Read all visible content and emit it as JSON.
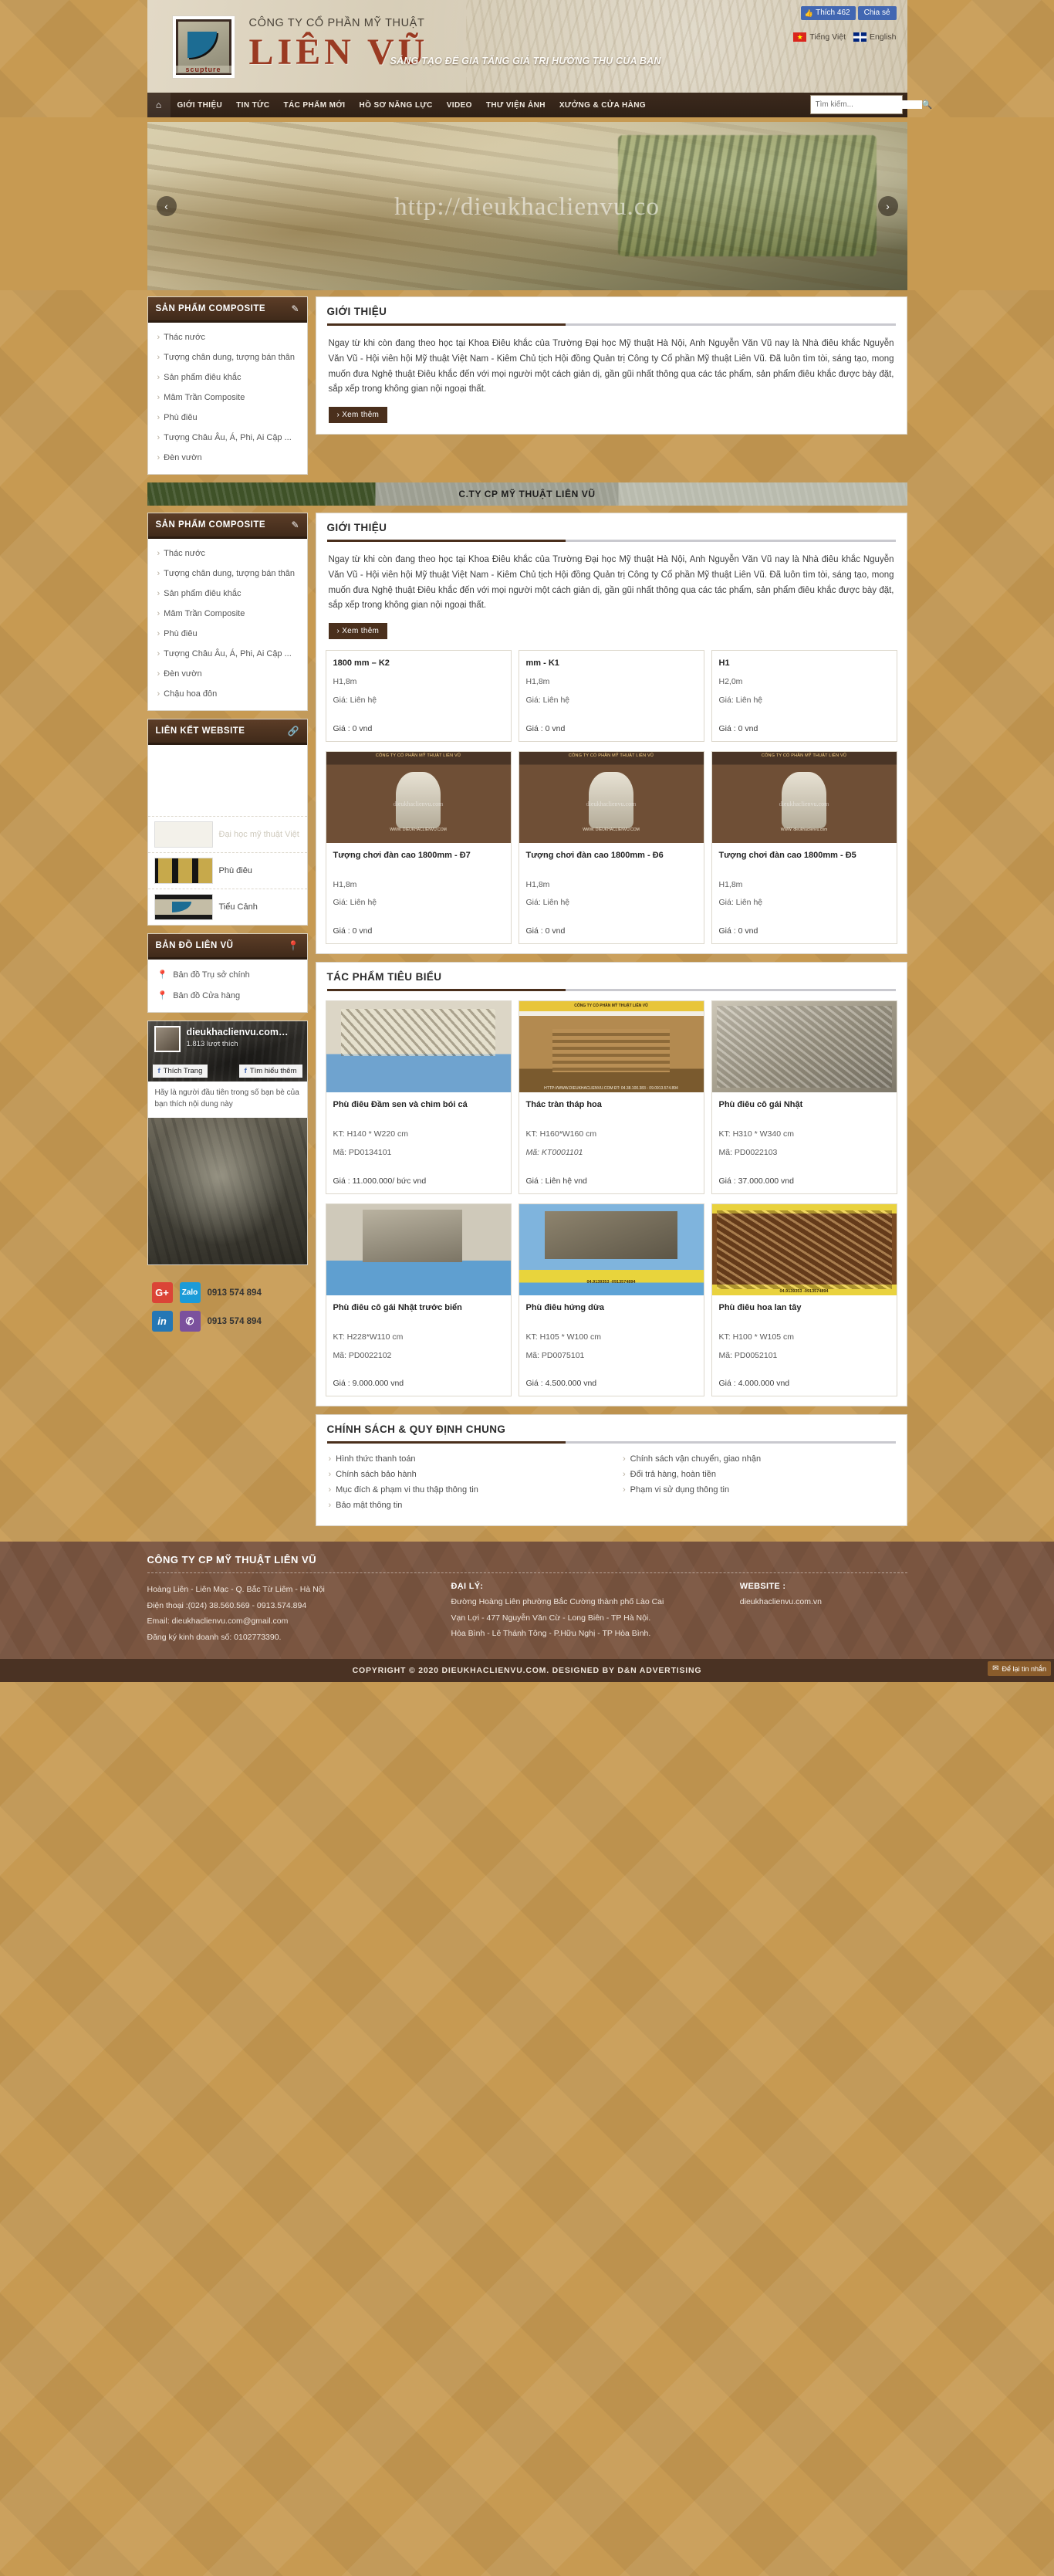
{
  "header": {
    "company_sub": "CÔNG TY CỔ PHẦN MỸ THUẬT",
    "company_main": "LIÊN VŨ",
    "tagline": "SÁNG TẠO ĐỂ GIA TĂNG GIÁ TRỊ HƯỞNG THỤ CỦA BẠN",
    "logo_word": "scupture",
    "fb_like": "Thích 462",
    "fb_share": "Chia sẻ",
    "lang_vi": "Tiếng Việt",
    "lang_en": "English"
  },
  "nav": {
    "home_icon": "home-icon",
    "items": [
      "GIỚI THIỆU",
      "TIN TỨC",
      "TÁC PHẨM MỚI",
      "HỒ SƠ NĂNG LỰC",
      "VIDEO",
      "THƯ VIỆN ẢNH",
      "XƯỞNG & CỬA HÀNG"
    ],
    "search_placeholder": "Tìm kiếm...",
    "search_value": ""
  },
  "slider": {
    "watermark": "http://dieukhaclienvu.co",
    "prev": "‹",
    "next": "›"
  },
  "sidebar": {
    "composite_panel": {
      "title": "SẢN PHẨM COMPOSITE",
      "icon": "edit-icon",
      "items": [
        "Thác nước",
        "Tượng chân dung, tượng bán thân",
        "Sản phẩm điêu khắc",
        "Mâm Trần Composite",
        "Phù điêu",
        "Tượng Châu Âu, Á, Phi, Ai Cập ...",
        "Đèn vườn",
        "Chậu hoa đôn"
      ]
    },
    "links_panel": {
      "title": "LIÊN KẾT WEBSITE",
      "icon": "link-icon",
      "items": [
        {
          "label": "Đại học mỹ thuật Việt"
        },
        {
          "label": "Phù điêu"
        },
        {
          "label": "Tiểu Cảnh"
        }
      ]
    },
    "map_panel": {
      "title": "BẢN ĐỒ LIÊN VŨ",
      "icon": "map-pin-icon",
      "items": [
        "Bản đồ Trụ sở chính",
        "Bản đồ Cửa hàng"
      ]
    },
    "facebook": {
      "page_name": "dieukhaclienvu.com…",
      "likes": "1.813 lượt thích",
      "like_btn": "Thích Trang",
      "learn_btn": "Tìm hiểu thêm",
      "note": "Hãy là người đầu tiên trong số bạn bè của bạn thích nội dung này"
    },
    "social": [
      {
        "icon": "google-plus-icon",
        "icon2": "zalo-icon",
        "phone": "0913 574 894"
      },
      {
        "icon": "linkedin-icon",
        "icon2": "viber-icon",
        "phone": "0913 574 894"
      }
    ]
  },
  "intro_block": {
    "title": "GIỚI THIỆU",
    "text": "Ngay từ khi còn đang theo học tại Khoa Điêu khắc của Trường Đại học Mỹ thuật Hà Nội, Anh Nguyễn Văn Vũ nay là Nhà điêu khắc Nguyễn Văn Vũ - Hội viên hội Mỹ thuật Việt Nam - Kiêm Chủ tịch Hội đồng Quản trị Công ty Cổ phần Mỹ thuật Liên Vũ. Đã luôn tìm tòi, sáng tạo, mong muốn đưa Nghệ thuật Điêu khắc đến với mọi người một cách giản dị, gần gũi nhất thông qua các tác phẩm, sản phẩm điêu khắc được bày đặt, sắp xếp trong không gian nội ngoại thất.",
    "more": "› Xem thêm"
  },
  "mid_banner": {
    "text": "C.TY CP MỸ THUẬT LIÊN VŨ"
  },
  "products_row1": [
    {
      "name": "1800 mm – K2",
      "size": "H1,8m",
      "contact": "Giá: Liên hệ",
      "price": "Giá : 0 vnd"
    },
    {
      "name": "mm - K1",
      "size": "H1,8m",
      "contact": "Giá: Liên hệ",
      "price": "Giá : 0 vnd"
    },
    {
      "name": "H1",
      "size": "H2,0m",
      "contact": "Giá: Liên hệ",
      "price": "Giá : 0 vnd"
    }
  ],
  "products_row2": [
    {
      "img_label": "CÔNG TY CỔ PHẦN MỸ THUẬT LIÊN VŨ",
      "img_url": "WWW. DIEUKHACLIENVU.COM",
      "img_wm": "dieukhaclienvu.com",
      "name": "Tượng chơi đàn cao 1800mm - Đ7",
      "size": "H1,8m",
      "contact": "Giá: Liên hệ",
      "price": "Giá : 0 vnd"
    },
    {
      "img_label": "CÔNG TY CỔ PHẦN MỸ THUẬT LIÊN VŨ",
      "img_url": "WWW. DIEUKHACLIENVU.COM",
      "img_wm": "dieukhaclienvu.com",
      "name": "Tượng chơi đàn cao 1800mm - Đ6",
      "size": "H1,8m",
      "contact": "Giá: Liên hệ",
      "price": "Giá : 0 vnd"
    },
    {
      "img_label": "CÔNG TY CỔ PHẦN MỸ THUẬT LIÊN VŨ",
      "img_url": "WWW. dieukhaclienvu.com",
      "img_wm": "dieukhaclienvu.com",
      "name": "Tượng chơi đàn cao 1800mm - Đ5",
      "size": "H1,8m",
      "contact": "Giá: Liên hệ",
      "price": "Giá : 0 vnd"
    }
  ],
  "featured_block": {
    "title": "TÁC PHẨM TIÊU BIỂU"
  },
  "featured_row1": [
    {
      "name": "Phù điêu Đầm sen và chim bói cá",
      "kt": "KT: H140 * W220 cm",
      "ma": "Mã: PD0134101",
      "price": "Giá : 11.000.000/ bức vnd"
    },
    {
      "name": "Thác tràn tháp hoa",
      "kt": "KT: H160*W160 cm",
      "ma": "Mã: KT0001101",
      "price": "Giá : Liên hệ vnd",
      "img_band": "CÔNG TY CỔ PHẦN MỸ THUẬT LIÊN VŨ",
      "img_url": "HTTP://WWW.DIEUKHACLIENVU.COM  ĐT: 04.38.100.383 - 09.0913.574.894"
    },
    {
      "name": "Phù điêu cô gái Nhật",
      "kt": "KT: H310 * W340 cm",
      "ma": "Mã: PD0022103",
      "price": "Giá : 37.000.000 vnd"
    }
  ],
  "featured_row2": [
    {
      "name": "Phù điêu cô gái Nhật trước biển",
      "kt": "KT: H228*W110 cm",
      "ma": "Mã: PD0022102",
      "price": "Giá : 9.000.000 vnd"
    },
    {
      "name": "Phù điêu hứng dừa",
      "kt": "KT: H105 * W100 cm",
      "ma": "Mã: PD0075101",
      "price": "Giá : 4.500.000 vnd",
      "img_tag": "04.9139353 -0913574894"
    },
    {
      "name": "Phù điêu hoa lan tây",
      "kt": "KT: H100 * W105 cm",
      "ma": "Mã: PD0052101",
      "price": "Giá : 4.000.000 vnd",
      "img_tag": "04.9139353 -0913574894"
    }
  ],
  "policy_block": {
    "title": "CHÍNH SÁCH & QUY ĐỊNH CHUNG",
    "left": [
      "Hình thức thanh toán",
      "Chính sách bảo hành",
      "Mục đích & phạm vi thu thập thông tin",
      "Bảo mật thông tin"
    ],
    "right": [
      "Chính sách vận chuyển, giao nhận",
      "Đổi trả hàng, hoàn tiền",
      "Phạm vi sử dụng thông tin"
    ]
  },
  "footer": {
    "title": "CÔNG TY CP MỸ THUẬT LIÊN VŨ",
    "col1": [
      "Hoàng Liên - Liên Mạc - Q. Bắc Từ Liêm - Hà Nội",
      "Điện thoại :(024) 38.560.569 - 0913.574.894",
      "Email: dieukhaclienvu.com@gmail.com",
      "Đăng ký kinh doanh số: 0102773390."
    ],
    "col2_head": "ĐẠI LÝ:",
    "col2": [
      "Đường Hoàng Liên phường Bắc Cường thành phố Lào Cai",
      "Vạn Lợi - 477 Nguyễn Văn Cừ - Long Biên - TP Hà Nội.",
      "Hòa Bình - Lê Thánh Tông - P.Hữu Nghị - TP Hòa Bình."
    ],
    "col3_head": "WEBSITE :",
    "col3": [
      "dieukhaclienvu.com.vn"
    ],
    "copyright": "COPYRIGHT © 2020 DIEUKHACLIENVU.COM. DESIGNED BY D&N ADVERTISING",
    "tab": "Để lại tin nhắn"
  }
}
